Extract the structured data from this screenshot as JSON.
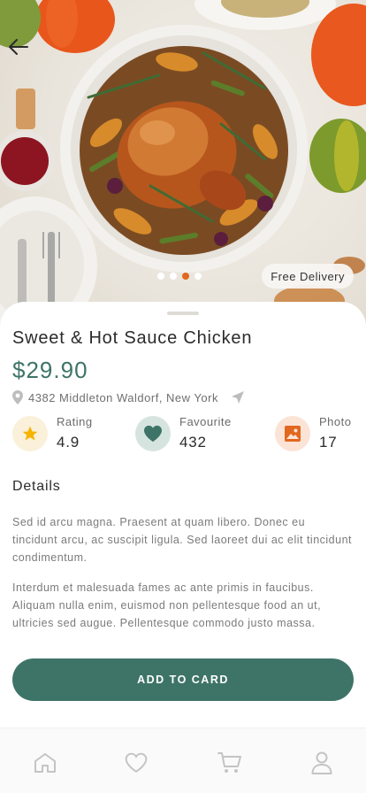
{
  "hero": {
    "image_description": "roast-chicken-with-vegetables",
    "slides": {
      "count": 4,
      "active_index": 2
    },
    "delivery_badge": "Free Delivery"
  },
  "product": {
    "name": "Sweet & Hot Sauce Chicken",
    "price": "$29.90",
    "address": "4382 Middleton Waldorf, New York"
  },
  "stats": [
    {
      "label": "Rating",
      "value": "4.9",
      "icon": "star-icon",
      "color": "#f6b400",
      "bg": "#fbf0d9"
    },
    {
      "label": "Favourite",
      "value": "432",
      "icon": "heart-icon",
      "color": "#3e7468",
      "bg": "#d6e4e0"
    },
    {
      "label": "Photo",
      "value": "17",
      "icon": "image-icon",
      "color": "#e2671f",
      "bg": "#fbe3d6"
    }
  ],
  "details": {
    "heading": "Details",
    "paragraph_1": "Sed id arcu magna. Praesent at quam libero. Donec eu tincidunt arcu, ac suscipit ligula. Sed laoreet dui ac elit tincidunt condimentum.",
    "paragraph_2": "Interdum et malesuada fames ac ante  primis in faucibus. Aliquam nulla enim, euismod non pellentesque food an ut, ultricies sed augue. Pellentesque commodo justo massa."
  },
  "cta": {
    "label": "ADD TO CARD"
  },
  "bottom_nav": [
    {
      "icon": "home-icon"
    },
    {
      "icon": "heart-outline-icon"
    },
    {
      "icon": "cart-icon"
    },
    {
      "icon": "user-icon"
    }
  ],
  "colors": {
    "accent": "#3e7468",
    "orange": "#e2671f",
    "star": "#f6b400"
  }
}
